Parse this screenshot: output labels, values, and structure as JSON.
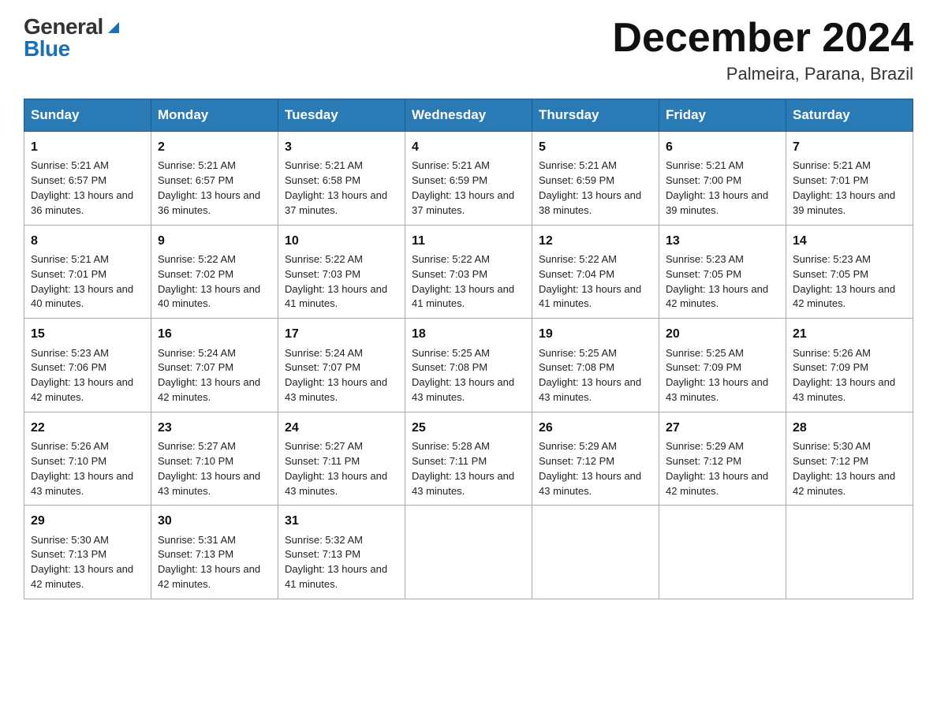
{
  "header": {
    "logo_general": "General",
    "logo_blue": "Blue",
    "month_title": "December 2024",
    "location": "Palmeira, Parana, Brazil"
  },
  "days_of_week": [
    "Sunday",
    "Monday",
    "Tuesday",
    "Wednesday",
    "Thursday",
    "Friday",
    "Saturday"
  ],
  "weeks": [
    [
      {
        "day": "1",
        "sunrise": "5:21 AM",
        "sunset": "6:57 PM",
        "daylight": "13 hours and 36 minutes."
      },
      {
        "day": "2",
        "sunrise": "5:21 AM",
        "sunset": "6:57 PM",
        "daylight": "13 hours and 36 minutes."
      },
      {
        "day": "3",
        "sunrise": "5:21 AM",
        "sunset": "6:58 PM",
        "daylight": "13 hours and 37 minutes."
      },
      {
        "day": "4",
        "sunrise": "5:21 AM",
        "sunset": "6:59 PM",
        "daylight": "13 hours and 37 minutes."
      },
      {
        "day": "5",
        "sunrise": "5:21 AM",
        "sunset": "6:59 PM",
        "daylight": "13 hours and 38 minutes."
      },
      {
        "day": "6",
        "sunrise": "5:21 AM",
        "sunset": "7:00 PM",
        "daylight": "13 hours and 39 minutes."
      },
      {
        "day": "7",
        "sunrise": "5:21 AM",
        "sunset": "7:01 PM",
        "daylight": "13 hours and 39 minutes."
      }
    ],
    [
      {
        "day": "8",
        "sunrise": "5:21 AM",
        "sunset": "7:01 PM",
        "daylight": "13 hours and 40 minutes."
      },
      {
        "day": "9",
        "sunrise": "5:22 AM",
        "sunset": "7:02 PM",
        "daylight": "13 hours and 40 minutes."
      },
      {
        "day": "10",
        "sunrise": "5:22 AM",
        "sunset": "7:03 PM",
        "daylight": "13 hours and 41 minutes."
      },
      {
        "day": "11",
        "sunrise": "5:22 AM",
        "sunset": "7:03 PM",
        "daylight": "13 hours and 41 minutes."
      },
      {
        "day": "12",
        "sunrise": "5:22 AM",
        "sunset": "7:04 PM",
        "daylight": "13 hours and 41 minutes."
      },
      {
        "day": "13",
        "sunrise": "5:23 AM",
        "sunset": "7:05 PM",
        "daylight": "13 hours and 42 minutes."
      },
      {
        "day": "14",
        "sunrise": "5:23 AM",
        "sunset": "7:05 PM",
        "daylight": "13 hours and 42 minutes."
      }
    ],
    [
      {
        "day": "15",
        "sunrise": "5:23 AM",
        "sunset": "7:06 PM",
        "daylight": "13 hours and 42 minutes."
      },
      {
        "day": "16",
        "sunrise": "5:24 AM",
        "sunset": "7:07 PM",
        "daylight": "13 hours and 42 minutes."
      },
      {
        "day": "17",
        "sunrise": "5:24 AM",
        "sunset": "7:07 PM",
        "daylight": "13 hours and 43 minutes."
      },
      {
        "day": "18",
        "sunrise": "5:25 AM",
        "sunset": "7:08 PM",
        "daylight": "13 hours and 43 minutes."
      },
      {
        "day": "19",
        "sunrise": "5:25 AM",
        "sunset": "7:08 PM",
        "daylight": "13 hours and 43 minutes."
      },
      {
        "day": "20",
        "sunrise": "5:25 AM",
        "sunset": "7:09 PM",
        "daylight": "13 hours and 43 minutes."
      },
      {
        "day": "21",
        "sunrise": "5:26 AM",
        "sunset": "7:09 PM",
        "daylight": "13 hours and 43 minutes."
      }
    ],
    [
      {
        "day": "22",
        "sunrise": "5:26 AM",
        "sunset": "7:10 PM",
        "daylight": "13 hours and 43 minutes."
      },
      {
        "day": "23",
        "sunrise": "5:27 AM",
        "sunset": "7:10 PM",
        "daylight": "13 hours and 43 minutes."
      },
      {
        "day": "24",
        "sunrise": "5:27 AM",
        "sunset": "7:11 PM",
        "daylight": "13 hours and 43 minutes."
      },
      {
        "day": "25",
        "sunrise": "5:28 AM",
        "sunset": "7:11 PM",
        "daylight": "13 hours and 43 minutes."
      },
      {
        "day": "26",
        "sunrise": "5:29 AM",
        "sunset": "7:12 PM",
        "daylight": "13 hours and 43 minutes."
      },
      {
        "day": "27",
        "sunrise": "5:29 AM",
        "sunset": "7:12 PM",
        "daylight": "13 hours and 42 minutes."
      },
      {
        "day": "28",
        "sunrise": "5:30 AM",
        "sunset": "7:12 PM",
        "daylight": "13 hours and 42 minutes."
      }
    ],
    [
      {
        "day": "29",
        "sunrise": "5:30 AM",
        "sunset": "7:13 PM",
        "daylight": "13 hours and 42 minutes."
      },
      {
        "day": "30",
        "sunrise": "5:31 AM",
        "sunset": "7:13 PM",
        "daylight": "13 hours and 42 minutes."
      },
      {
        "day": "31",
        "sunrise": "5:32 AM",
        "sunset": "7:13 PM",
        "daylight": "13 hours and 41 minutes."
      },
      null,
      null,
      null,
      null
    ]
  ],
  "labels": {
    "sunrise": "Sunrise:",
    "sunset": "Sunset:",
    "daylight": "Daylight:"
  }
}
